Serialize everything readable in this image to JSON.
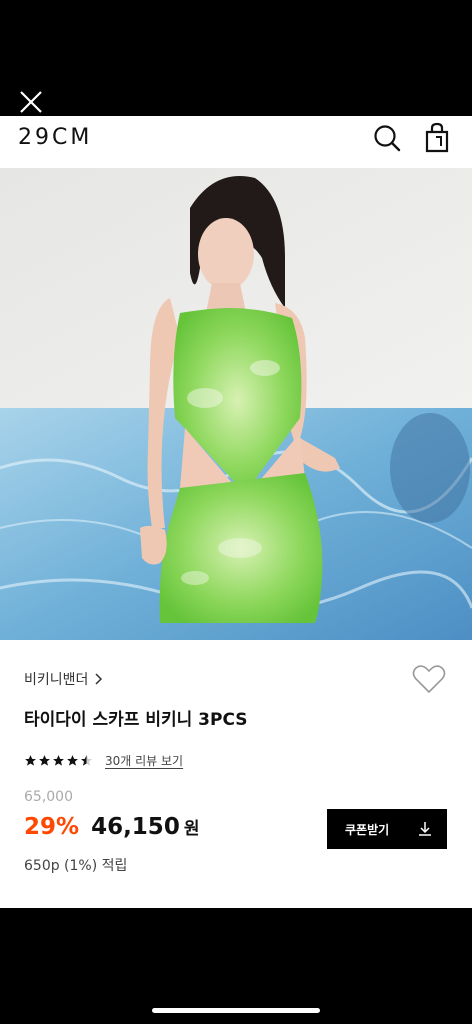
{
  "header": {
    "logo": "29CM"
  },
  "product": {
    "brand": "비키니밴더",
    "title": "타이다이 스카프 비키니 3PCS",
    "rating": 4.5,
    "review_link": "30개 리뷰 보기",
    "original_price": "65,000",
    "discount": "29%",
    "final_price": "46,150",
    "currency": "원",
    "points": "650p (1%) 적립"
  },
  "coupon": {
    "label": "쿠폰받기"
  },
  "colors": {
    "accent": "#ff4800",
    "text": "#111111",
    "muted": "#aaaaaa",
    "button": "#000000"
  },
  "icons": [
    "close-icon",
    "search-icon",
    "shopping-bag-icon",
    "chevron-right-icon",
    "heart-icon",
    "star-icon",
    "download-icon"
  ]
}
